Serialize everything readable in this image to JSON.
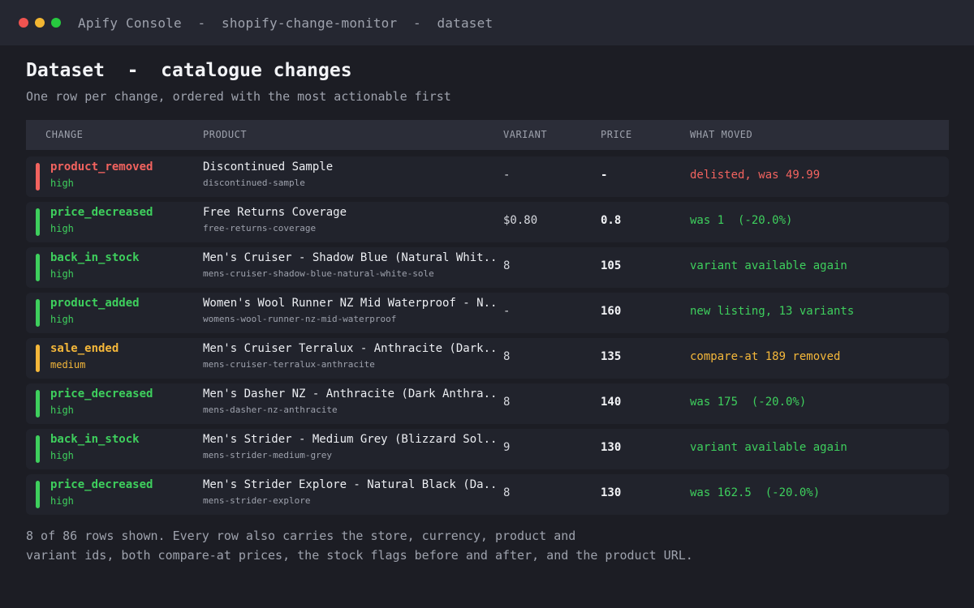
{
  "window": {
    "title": "Apify Console  -  shopify-change-monitor  -  dataset",
    "dots": [
      "#ef5350",
      "#f2b632",
      "#27c93f"
    ]
  },
  "page": {
    "title": "Dataset  -  catalogue changes",
    "subtitle": "One row per change, ordered with the most actionable first"
  },
  "colors": {
    "high_removed": "#f2635f",
    "high_green": "#3ecf5d",
    "medium_amber": "#f4b73a"
  },
  "table": {
    "columns": [
      "CHANGE",
      "PRODUCT",
      "VARIANT",
      "PRICE",
      "WHAT MOVED"
    ],
    "rows": [
      {
        "change_type": "product_removed",
        "severity": "high",
        "accent": "#f2635f",
        "severity_color": "#3ecf5d",
        "product_title": "Discontinued Sample",
        "product_handle": "discontinued-sample",
        "variant": "-",
        "price": "-",
        "moved": "delisted, was 49.99"
      },
      {
        "change_type": "price_decreased",
        "severity": "high",
        "accent": "#3ecf5d",
        "severity_color": "#3ecf5d",
        "product_title": "Free Returns Coverage",
        "product_handle": "free-returns-coverage",
        "variant": "$0.80",
        "price": "0.8",
        "moved": "was 1  (-20.0%)"
      },
      {
        "change_type": "back_in_stock",
        "severity": "high",
        "accent": "#3ecf5d",
        "severity_color": "#3ecf5d",
        "product_title": "Men's Cruiser - Shadow Blue (Natural Whit...",
        "product_handle": "mens-cruiser-shadow-blue-natural-white-sole",
        "variant": "8",
        "price": "105",
        "moved": "variant available again"
      },
      {
        "change_type": "product_added",
        "severity": "high",
        "accent": "#3ecf5d",
        "severity_color": "#3ecf5d",
        "product_title": "Women's Wool Runner NZ Mid Waterproof - N...",
        "product_handle": "womens-wool-runner-nz-mid-waterproof",
        "variant": "-",
        "price": "160",
        "moved": "new listing, 13 variants"
      },
      {
        "change_type": "sale_ended",
        "severity": "medium",
        "accent": "#f4b73a",
        "severity_color": "#f4b73a",
        "product_title": "Men's Cruiser Terralux - Anthracite (Dark...",
        "product_handle": "mens-cruiser-terralux-anthracite",
        "variant": "8",
        "price": "135",
        "moved": "compare-at 189 removed"
      },
      {
        "change_type": "price_decreased",
        "severity": "high",
        "accent": "#3ecf5d",
        "severity_color": "#3ecf5d",
        "product_title": "Men's Dasher NZ - Anthracite (Dark Anthra...",
        "product_handle": "mens-dasher-nz-anthracite",
        "variant": "8",
        "price": "140",
        "moved": "was 175  (-20.0%)"
      },
      {
        "change_type": "back_in_stock",
        "severity": "high",
        "accent": "#3ecf5d",
        "severity_color": "#3ecf5d",
        "product_title": "Men's Strider - Medium Grey (Blizzard Sol...",
        "product_handle": "mens-strider-medium-grey",
        "variant": "9",
        "price": "130",
        "moved": "variant available again"
      },
      {
        "change_type": "price_decreased",
        "severity": "high",
        "accent": "#3ecf5d",
        "severity_color": "#3ecf5d",
        "product_title": "Men's Strider Explore - Natural Black (Da...",
        "product_handle": "mens-strider-explore",
        "variant": "8",
        "price": "130",
        "moved": "was 162.5  (-20.0%)"
      }
    ]
  },
  "footer": {
    "line1": "8 of 86 rows shown. Every row also carries the store, currency, product and",
    "line2": "variant ids, both compare-at prices, the stock flags before and after, and the product URL."
  }
}
